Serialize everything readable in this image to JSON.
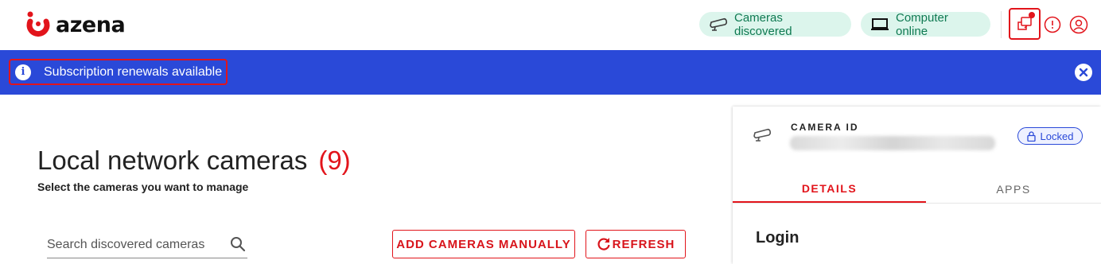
{
  "header": {
    "logo_text": "azena",
    "status_cameras": "Cameras discovered",
    "status_computer": "Computer online",
    "colors": {
      "brand_red": "#e2141b",
      "status_bg": "#dcf5ec",
      "status_text": "#0f7a52"
    },
    "icons": [
      "camera-icon",
      "laptop-icon",
      "notifications-icon",
      "info-icon",
      "user-icon"
    ]
  },
  "banner": {
    "message": "Subscription renewals available",
    "color": "#2a49d8"
  },
  "main": {
    "title": "Local network cameras",
    "count": "(9)",
    "subtitle": "Select the cameras you want to manage",
    "search_placeholder": "Search discovered cameras",
    "add_button": "ADD CAMERAS MANUALLY",
    "refresh_button": "REFRESH"
  },
  "panel": {
    "camera_id_label": "CAMERA ID",
    "locked_label": "Locked",
    "tabs": [
      {
        "label": "DETAILS",
        "active": true
      },
      {
        "label": "APPS",
        "active": false
      }
    ],
    "section_title": "Login"
  }
}
